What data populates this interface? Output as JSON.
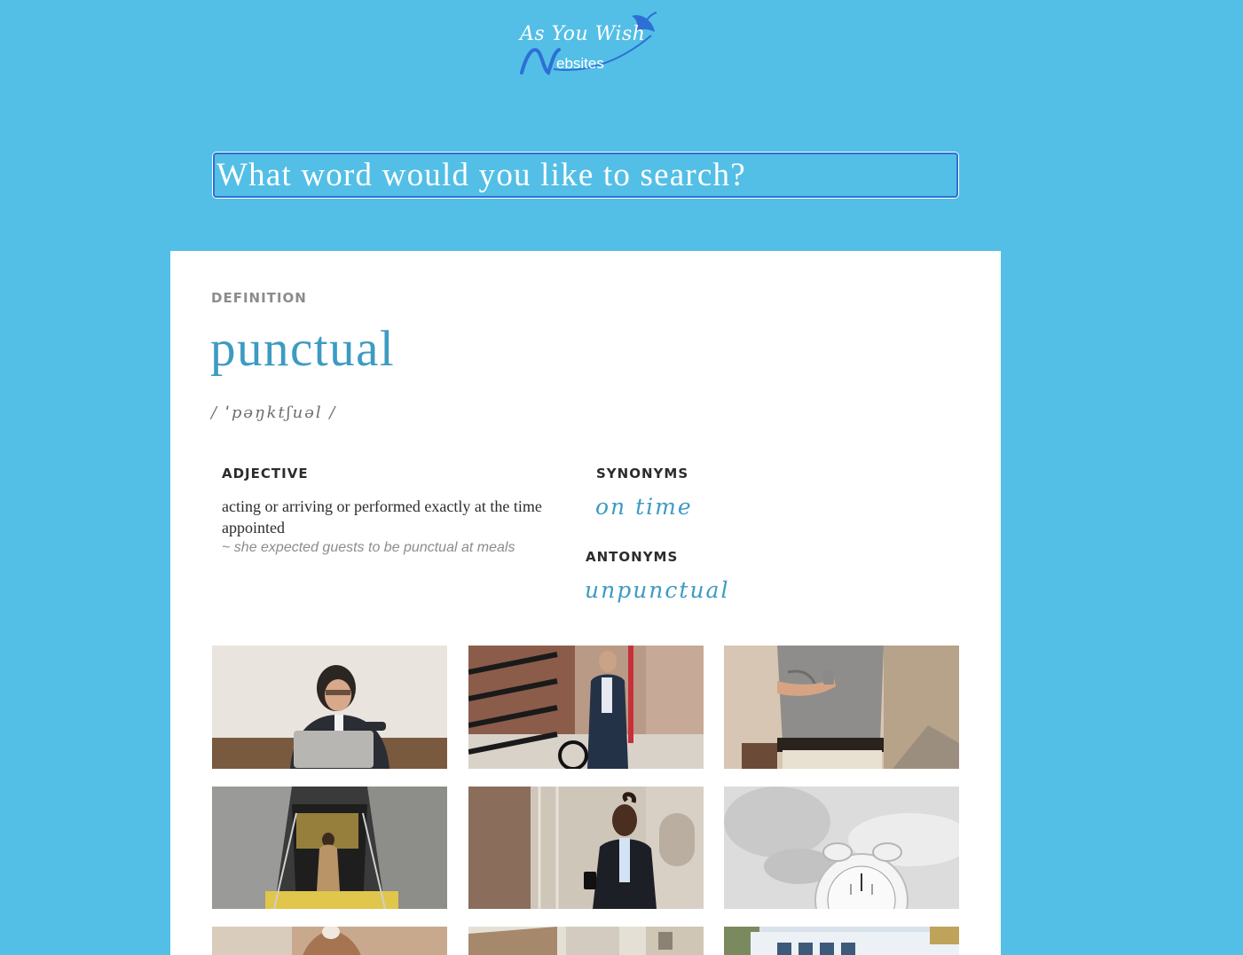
{
  "brand": {
    "script_text": "As You Wish",
    "sub_text": "ebsites",
    "accent_color": "#2e6fd6"
  },
  "search": {
    "placeholder": "What word would you like to search?",
    "value": ""
  },
  "definition": {
    "heading": "DEFINITION",
    "word": "punctual",
    "phonetic": "/ ˈpəŋktʃuəl /",
    "part_of_speech": "ADJECTIVE",
    "meaning": "acting or arriving or performed exactly at the time appointed",
    "example": "~ she expected guests to be punctual at meals",
    "synonyms_heading": "SYNONYMS",
    "synonyms": [
      "on time"
    ],
    "antonyms_heading": "ANTONYMS",
    "antonyms": [
      "unpunctual"
    ]
  },
  "photos": [
    {
      "icon": "person-checking-watch-at-laptop-photo"
    },
    {
      "icon": "man-with-bicycle-street-photo"
    },
    {
      "icon": "man-checking-wristwatch-photo"
    },
    {
      "icon": "man-on-escalator-photo"
    },
    {
      "icon": "man-with-phone-downtown-photo"
    },
    {
      "icon": "alarm-clock-photo"
    },
    {
      "icon": "person-in-coat-photo"
    },
    {
      "icon": "street-building-photo"
    },
    {
      "icon": "delivery-van-photo"
    }
  ],
  "colors": {
    "background": "#53bfe6",
    "accent": "#3d9bc2",
    "heading_gray": "#8c8c8c",
    "text_dark": "#2c2c2c"
  }
}
